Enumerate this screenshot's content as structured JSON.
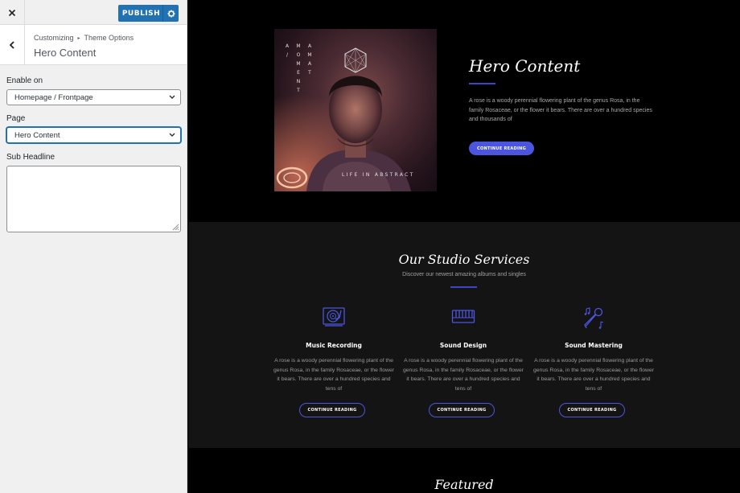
{
  "customizer": {
    "publish_label": "PUBLISH",
    "breadcrumb": {
      "root": "Customizing",
      "section": "Theme Options"
    },
    "section_title": "Hero Content",
    "controls": {
      "enable_on": {
        "label": "Enable on",
        "value": "Homepage / Frontpage"
      },
      "page": {
        "label": "Page",
        "value": "Hero Content"
      },
      "sub_headline": {
        "label": "Sub Headline",
        "value": ""
      }
    },
    "icons": {
      "close": "close-icon",
      "settings": "gear-icon",
      "back": "chevron-left-icon",
      "dropdown": "chevron-down-icon"
    },
    "colors": {
      "primary": "#2271b1",
      "sidebar_bg": "#f0f0f1"
    }
  },
  "preview": {
    "hero": {
      "album": {
        "col_left": "AMA/OME",
        "col_right": "AMAMENT",
        "bottom_text": "LIFE IN ABSTRACT"
      },
      "title": "Hero Content",
      "text": "A rose is a woody perennial flowering plant of the genus Rosa, in the family Rosaceae, or the flower it bears. There are over a hundred species and thousands of",
      "button": "CONTINUE READING"
    },
    "services": {
      "title": "Our Studio Services",
      "subtitle": "Discover our newest amazing albums and singles",
      "items": [
        {
          "title": "Music Recording",
          "icon": "turntable-icon",
          "text": "A rose is a woody perennial flowering plant of the genus Rosa, in the family Rosaceae, or the flower it bears. There are over a hundred species and tens of",
          "button": "CONTINUE READING"
        },
        {
          "title": "Sound Design",
          "icon": "synthesizer-icon",
          "text": "A rose is a woody perennial flowering plant of the genus Rosa, in the family Rosaceae, or the flower it bears. There are over a hundred species and tens of",
          "button": "CONTINUE READING"
        },
        {
          "title": "Sound Mastering",
          "icon": "microphone-icon",
          "text": "A rose is a woody perennial flowering plant of the genus Rosa, in the family Rosaceae, or the flower it bears. There are over a hundred species and tens of",
          "button": "CONTINUE READING"
        }
      ]
    },
    "featured": {
      "title": "Featured"
    },
    "colors": {
      "accent": "#4c55e0",
      "rule": "#3b45c9",
      "section_bg": "#141414"
    }
  }
}
